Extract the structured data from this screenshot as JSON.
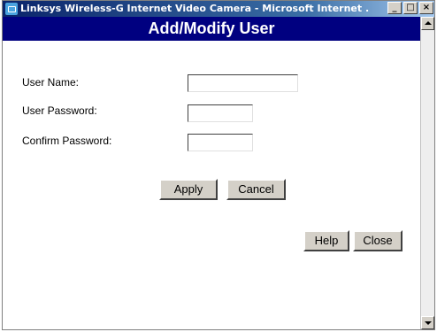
{
  "window": {
    "title": "Linksys Wireless-G Internet Video Camera - Microsoft Internet ...",
    "minimize_glyph": "_",
    "maximize_glyph": "□",
    "close_glyph": "×"
  },
  "header": {
    "title": "Add/Modify User"
  },
  "form": {
    "user_name_label": "User Name:",
    "user_name_value": "",
    "user_password_label": "User Password:",
    "user_password_value": "",
    "confirm_password_label": "Confirm Password:",
    "confirm_password_value": ""
  },
  "buttons": {
    "apply": "Apply",
    "cancel": "Cancel",
    "help": "Help",
    "close": "Close"
  },
  "colors": {
    "header_bg": "#000080",
    "titlebar": "#0a246a",
    "button_face": "#d4d0c8"
  }
}
